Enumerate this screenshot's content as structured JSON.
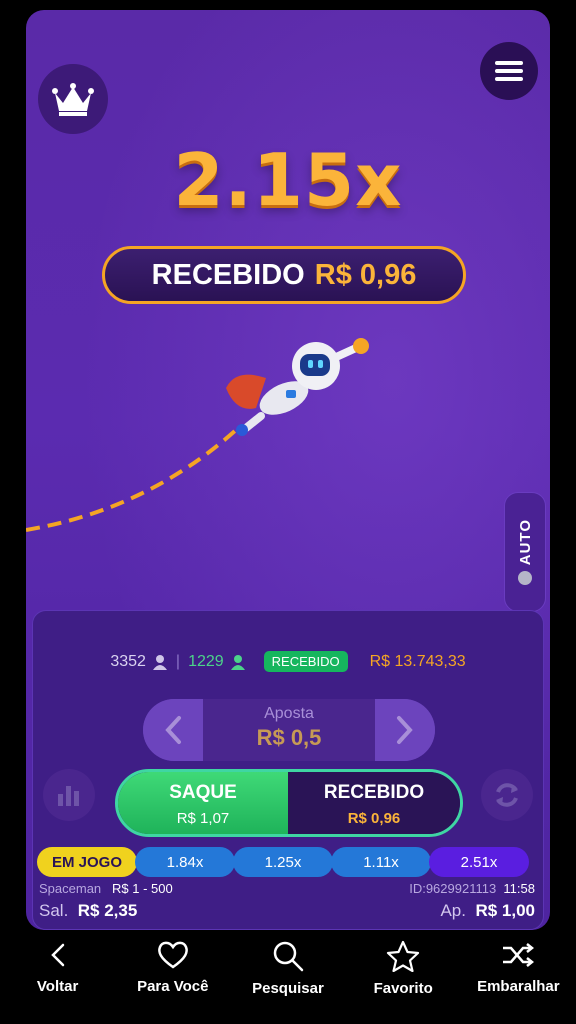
{
  "game": {
    "multiplier": "2.15x",
    "received_label": "RECEBIDO",
    "received_value": "R$ 0,96",
    "auto_label": "AUTO"
  },
  "stats": {
    "players": "3352",
    "cashed_out": "1229",
    "badge": "RECEBIDO",
    "total": "R$ 13.743,33"
  },
  "bet": {
    "label": "Aposta",
    "value": "R$ 0,5"
  },
  "actions": {
    "saque_label": "SAQUE",
    "saque_value": "R$ 1,07",
    "recebido_label": "RECEBIDO",
    "recebido_value": "R$ 0,96"
  },
  "history": {
    "current": "EM JOGO",
    "values": [
      "1.84x",
      "1.25x",
      "1.11x",
      "2.51x"
    ]
  },
  "info": {
    "game_name": "Spaceman",
    "limits": "R$ 1 - 500",
    "round_id": "ID:9629921113",
    "time": "11:58",
    "balance_label": "Sal.",
    "balance_value": "R$ 2,35",
    "bet_label": "Ap.",
    "bet_value": "R$ 1,00"
  },
  "nav": {
    "items": [
      {
        "label": "Voltar",
        "icon": "chevron-left-icon"
      },
      {
        "label": "Para Você",
        "icon": "heart-icon"
      },
      {
        "label": "Pesquisar",
        "icon": "search-icon"
      },
      {
        "label": "Favorito",
        "icon": "star-icon"
      },
      {
        "label": "Embaralhar",
        "icon": "shuffle-icon"
      }
    ]
  },
  "colors": {
    "accent_gold": "#fbb43a",
    "cashout_green": "#1fb35a",
    "background_purple": "#5a2aa8"
  }
}
